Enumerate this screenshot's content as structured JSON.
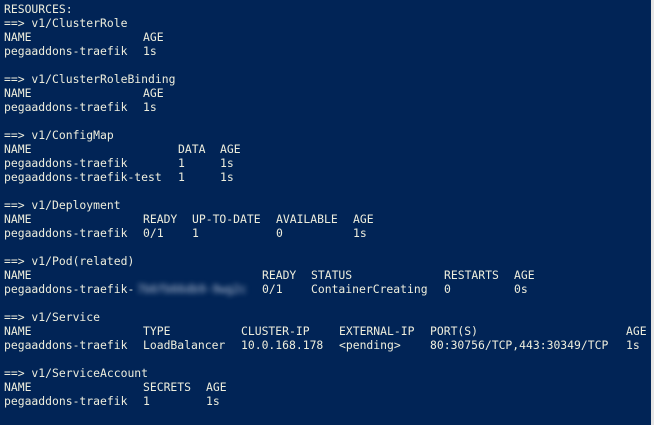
{
  "console": {
    "top_fragment": "-",
    "resources_header": "RESOURCES:",
    "sections": {
      "cluster_role": {
        "header": "==> v1/ClusterRole",
        "col_name": "NAME",
        "col_age": "AGE",
        "row": {
          "name": "pegaaddons-traefik",
          "age": "1s"
        }
      },
      "cluster_role_binding": {
        "header": "==> v1/ClusterRoleBinding",
        "col_name": "NAME",
        "col_age": "AGE",
        "row": {
          "name": "pegaaddons-traefik",
          "age": "1s"
        }
      },
      "config_map": {
        "header": "==> v1/ConfigMap",
        "col_name": "NAME",
        "col_data": "DATA",
        "col_age": "AGE",
        "rows": [
          {
            "name": "pegaaddons-traefik",
            "data": "1",
            "age": "1s"
          },
          {
            "name": "pegaaddons-traefik-test",
            "data": "1",
            "age": "1s"
          }
        ]
      },
      "deployment": {
        "header": "==> v1/Deployment",
        "col_name": "NAME",
        "col_ready": "READY",
        "col_up_to_date": "UP-TO-DATE",
        "col_available": "AVAILABLE",
        "col_age": "AGE",
        "row": {
          "name": "pegaaddons-traefik",
          "ready": "0/1",
          "up_to_date": "1",
          "available": "0",
          "age": "1s"
        }
      },
      "pod": {
        "header": "==> v1/Pod(related)",
        "col_name": "NAME",
        "col_ready": "READY",
        "col_status": "STATUS",
        "col_restarts": "RESTARTS",
        "col_age": "AGE",
        "row": {
          "name_prefix": "pegaaddons-traefik-",
          "name_suffix_redacted": "7b6fb66db9-9wg2c",
          "ready": "0/1",
          "status": "ContainerCreating",
          "restarts": "0",
          "age": "0s"
        }
      },
      "service": {
        "header": "==> v1/Service",
        "col_name": "NAME",
        "col_type": "TYPE",
        "col_cluster_ip": "CLUSTER-IP",
        "col_external_ip": "EXTERNAL-IP",
        "col_ports": "PORT(S)",
        "col_age": "AGE",
        "row": {
          "name": "pegaaddons-traefik",
          "type": "LoadBalancer",
          "cluster_ip": "10.0.168.178",
          "external_ip": "<pending>",
          "ports": "80:30756/TCP,443:30349/TCP",
          "age": "1s"
        }
      },
      "service_account": {
        "header": "==> v1/ServiceAccount",
        "col_name": "NAME",
        "col_secrets": "SECRETS",
        "col_age": "AGE",
        "row": {
          "name": "pegaaddons-traefik",
          "secrets": "1",
          "age": "1s"
        }
      }
    }
  },
  "colors": {
    "background": "#012456",
    "foreground": "#eeeedd"
  }
}
